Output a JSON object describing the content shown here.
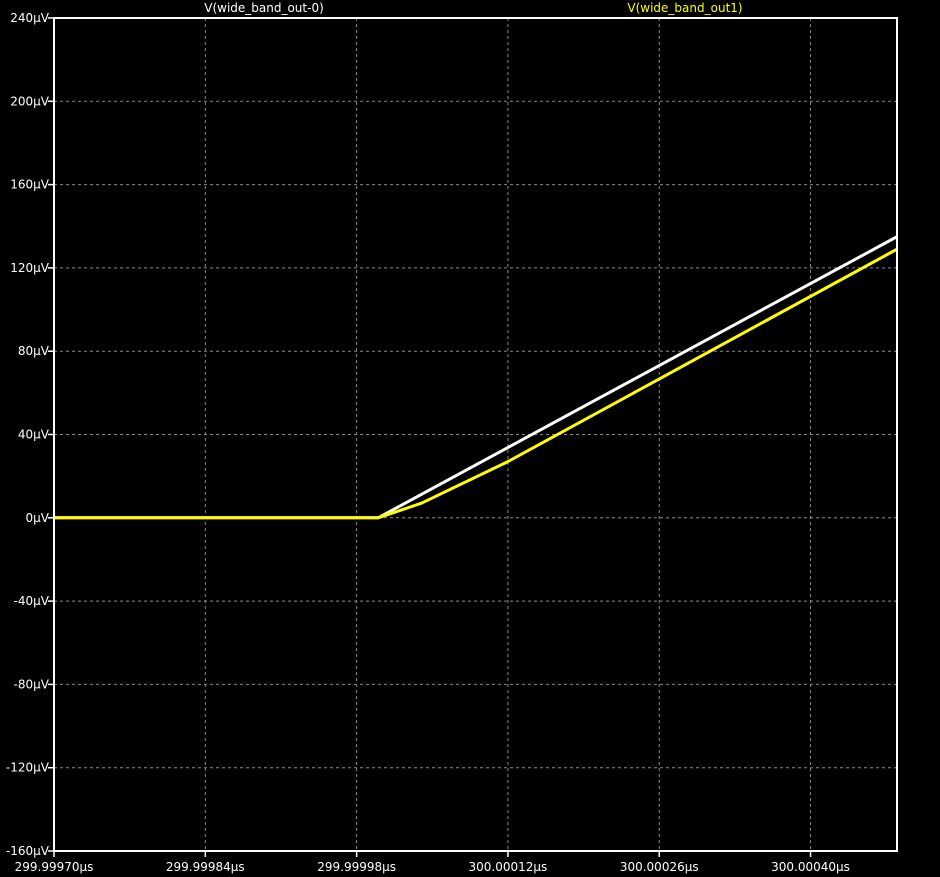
{
  "chart_data": {
    "type": "line",
    "title": "",
    "xlabel": "",
    "ylabel": "",
    "grid": true,
    "background": "#000000",
    "axis_color": "#ffffff",
    "grid_color": "#8a8a8a",
    "xlim": [
      299.9997,
      300.00048
    ],
    "ylim": [
      -160,
      240
    ],
    "x_unit": "µs",
    "y_unit": "µV",
    "x_ticks": [
      299.9997,
      299.99984,
      299.99998,
      300.00012,
      300.00026,
      300.0004
    ],
    "x_tick_labels": [
      "299.99970µs",
      "299.99984µs",
      "299.99998µs",
      "300.00012µs",
      "300.00026µs",
      "300.00040µs"
    ],
    "y_ticks": [
      240,
      200,
      160,
      120,
      80,
      40,
      0,
      -40,
      -80,
      -120,
      -160
    ],
    "y_tick_labels": [
      "240µV",
      "200µV",
      "160µV",
      "120µV",
      "80µV",
      "40µV",
      "0µV",
      "-40µV",
      "-80µV",
      "-120µV",
      "-160µV"
    ],
    "series": [
      {
        "name": "V(wide_band_out-0)",
        "color": "#ffffff",
        "x": [
          299.9997,
          300.0,
          300.00048
        ],
        "y": [
          0,
          0,
          135
        ]
      },
      {
        "name": "V(wide_band_out1)",
        "color": "#ffff00",
        "x": [
          299.9997,
          300.0,
          300.00004,
          300.00012,
          300.00048
        ],
        "y": [
          0,
          0,
          7,
          27,
          129
        ]
      }
    ]
  }
}
